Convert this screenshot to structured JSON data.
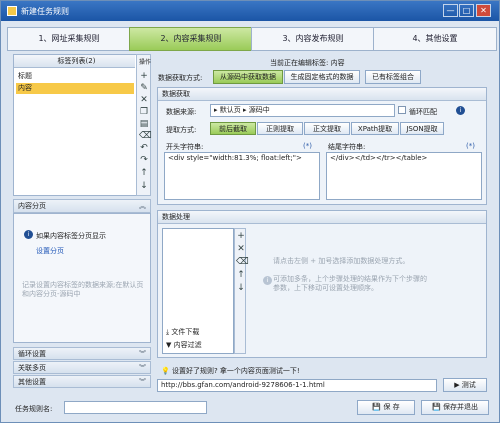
{
  "window": {
    "title": "新建任务规则",
    "minimize": "—",
    "maximize": "□",
    "close": "✕"
  },
  "steps": [
    "1、网址采集规则",
    "2、内容采集规则",
    "3、内容发布规则",
    "4、其他设置"
  ],
  "left": {
    "tag_list_title": "标签列表(2)",
    "ops_title": "操作",
    "tags": [
      "标题",
      "内容"
    ],
    "pagination_title": "内容分页",
    "pagination_hint": "如果内容标签分页显示",
    "pagination_link": "设置分页",
    "pagination_note": "记录设置内容标签的数据来源;在默认页和内容分页-源码中",
    "loop_settings": "循环设置",
    "multi_page": "关联多页",
    "other_settings": "其他设置"
  },
  "right": {
    "editing_label": "当前正在编辑标签: 内容",
    "fetch_mode_label": "数据获取方式:",
    "fetch_modes": [
      "从源码中获取数据",
      "生成固定格式的数据",
      "已有标签组合"
    ],
    "data_fetch_title": "数据获取",
    "source_label": "数据来源:",
    "source_parts": [
      "默认页",
      "源码中"
    ],
    "loop_match": "循环匹配",
    "extract_label": "提取方式:",
    "extract_modes": [
      "前后截取",
      "正则提取",
      "正文提取",
      "XPath提取",
      "JSON提取"
    ],
    "start_label": "开头字符串:",
    "end_label": "结尾字符串:",
    "wildcard": "(*)",
    "start_value": "<div style=\"width:81.3%; float:left;\">",
    "end_value": "</div></td></tr></table>",
    "processing_title": "数据处理",
    "proc_items": [
      "文件下载",
      "内容过滤"
    ],
    "proc_hint_1": "请点击左侧 + 加号选择添加数据处理方式。",
    "proc_hint_2": "可添加多条，上个步骤处理的结果作为下个步骤的参数，上下移动可设置处理顺序。",
    "test_hint": "设置好了规则? 拿一个内容页面测试一下!",
    "test_url": "http://bbs.gfan.com/android-9278606-1-1.html",
    "test_button": "测试"
  },
  "footer": {
    "rule_name_label": "任务规则名:",
    "rule_name_value": "",
    "save": "保 存",
    "save_exit": "保存并退出"
  }
}
